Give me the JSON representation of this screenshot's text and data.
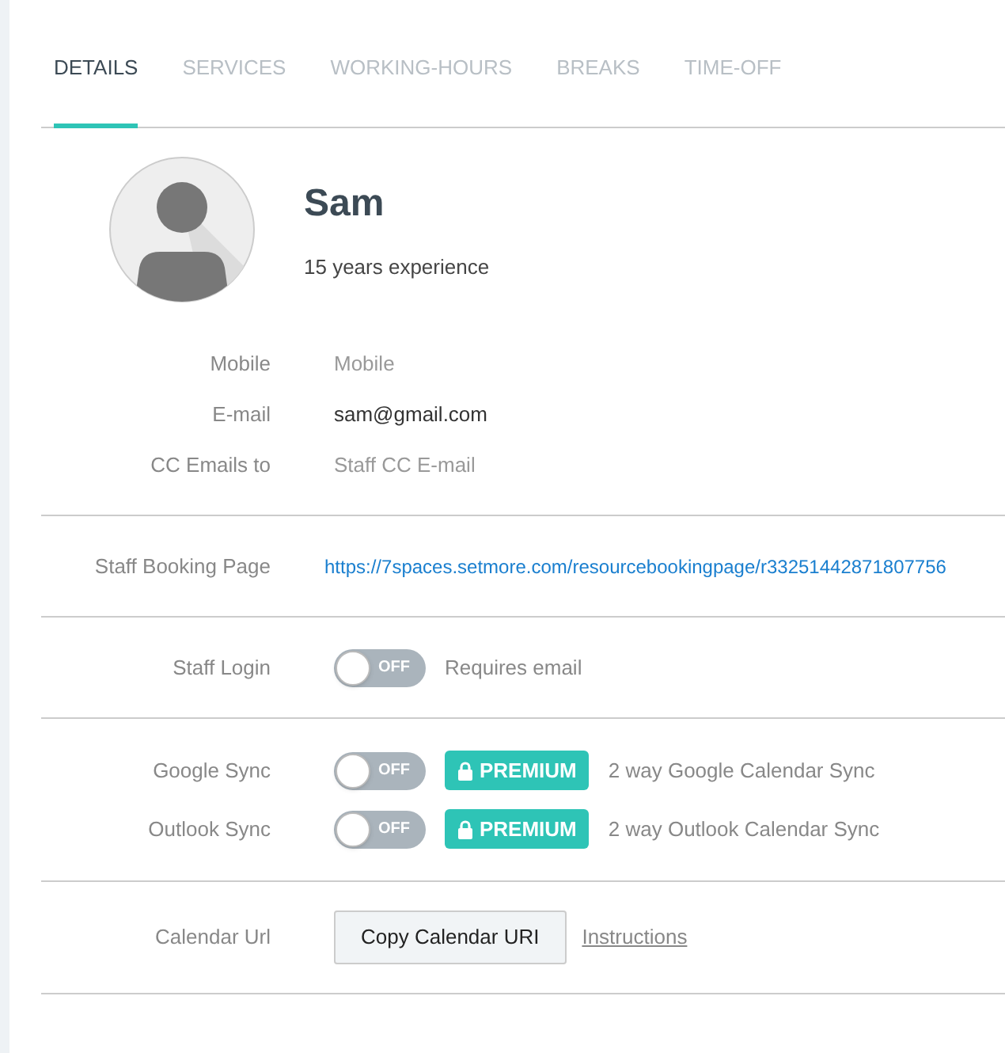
{
  "tabs": [
    {
      "label": "DETAILS",
      "selected": true
    },
    {
      "label": "SERVICES",
      "selected": false
    },
    {
      "label": "WORKING-HOURS",
      "selected": false
    },
    {
      "label": "BREAKS",
      "selected": false
    },
    {
      "label": "TIME-OFF",
      "selected": false
    }
  ],
  "profile": {
    "name": "Sam",
    "subtitle": "15 years experience"
  },
  "contact_fields": [
    {
      "label": "Mobile",
      "placeholder": "Mobile"
    },
    {
      "label": "E-mail",
      "value": "sam@gmail.com"
    },
    {
      "label": "CC Emails to",
      "placeholder": "Staff CC E-mail"
    }
  ],
  "booking_page": {
    "label": "Staff Booking Page",
    "url": "https://7spaces.setmore.com/resourcebookingpage/r33251442871807756"
  },
  "staff_login": {
    "label": "Staff Login",
    "toggle": {
      "on": false,
      "text": "OFF"
    },
    "note": "Requires email"
  },
  "sync": [
    {
      "label": "Google Sync",
      "toggle": {
        "on": false,
        "text": "OFF"
      },
      "badge": "PREMIUM",
      "description": "2 way Google Calendar Sync"
    },
    {
      "label": "Outlook Sync",
      "toggle": {
        "on": false,
        "text": "OFF"
      },
      "badge": "PREMIUM",
      "description": "2 way Outlook Calendar Sync"
    }
  ],
  "calendar_url": {
    "label": "Calendar Url",
    "button": "Copy Calendar URI",
    "link": "Instructions"
  }
}
